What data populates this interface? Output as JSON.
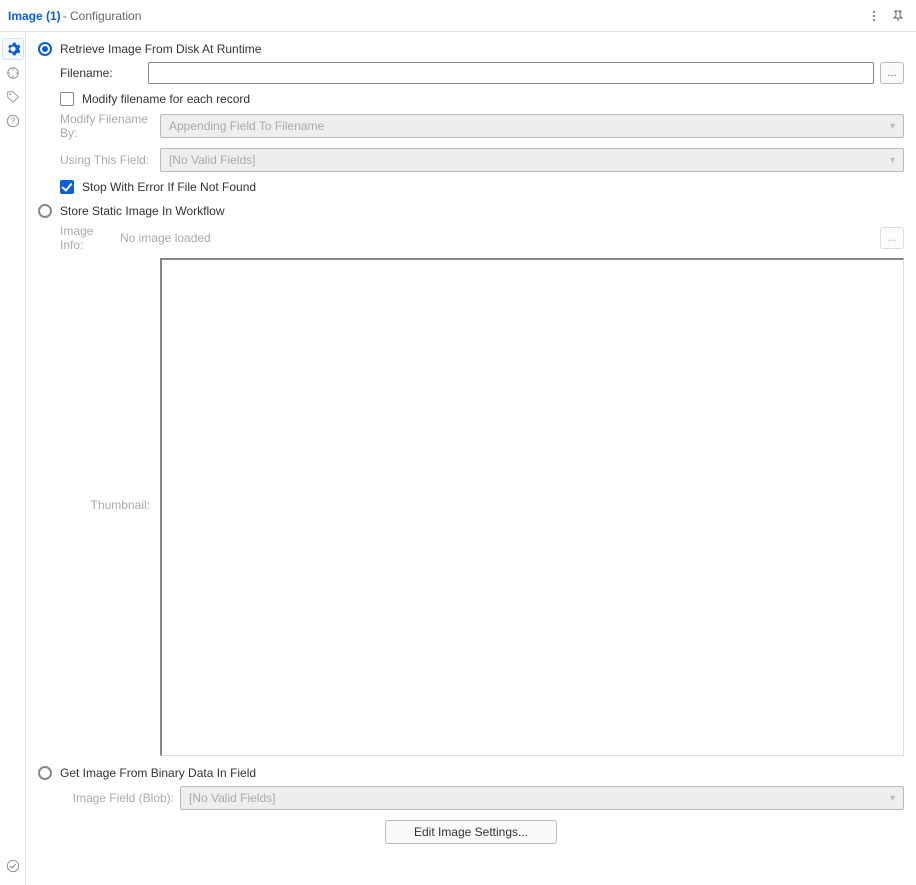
{
  "header": {
    "title": "Image (1)",
    "subtitle": " - Configuration"
  },
  "retrieve": {
    "radio_label": "Retrieve Image From Disk At Runtime",
    "filename_label": "Filename:",
    "filename_value": "",
    "browse_label": "...",
    "modify_checkbox_label": "Modify filename for each record",
    "modify_by_label": "Modify Filename By:",
    "modify_by_value": "Appending Field To Filename",
    "using_field_label": "Using This Field:",
    "using_field_value": "[No Valid Fields]",
    "stop_error_label": "Stop With Error If File Not Found"
  },
  "static": {
    "radio_label": "Store Static Image In Workflow",
    "image_info_label": "Image Info:",
    "image_info_value": "No image loaded",
    "browse_label": "...",
    "thumbnail_label": "Thumbnail:"
  },
  "binary": {
    "radio_label": "Get Image From Binary Data In Field",
    "image_field_label": "Image Field (Blob):",
    "image_field_value": "[No Valid Fields]"
  },
  "footer": {
    "edit_settings_label": "Edit Image Settings..."
  }
}
